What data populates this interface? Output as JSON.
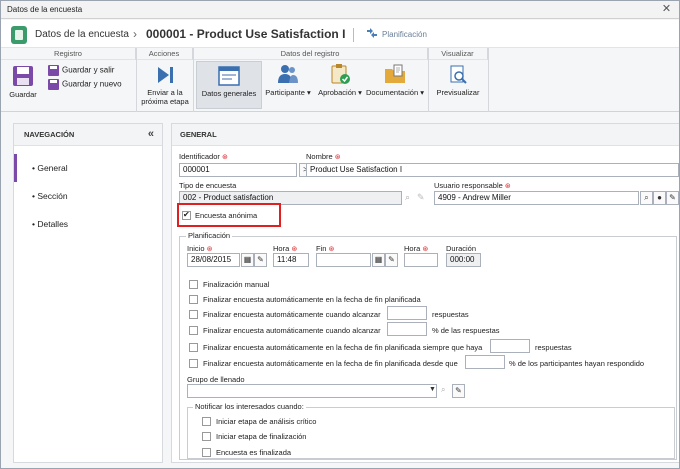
{
  "window": {
    "title": "Datos de la encuesta",
    "close_glyph": "✕"
  },
  "header": {
    "breadcrumb": "Datos de la encuesta",
    "separator": "›",
    "record_title": "000001 - Product Use Satisfaction I",
    "divider": "|",
    "planning_link": "Planificación",
    "app_icon": "survey-app-icon"
  },
  "ribbon": {
    "groups": [
      "Registro",
      "Acciones",
      "Datos del registro",
      "Visualizar"
    ],
    "save": "Guardar",
    "save_exit": "Guardar y salir",
    "save_new": "Guardar y nuevo",
    "send_next_1": "Enviar a la",
    "send_next_2": "próxima etapa",
    "general_data": "Datos generales",
    "participant": "Participante",
    "approval": "Aprobación",
    "documentation": "Documentación",
    "preview": "Previsualizar",
    "dropdown_glyph": "▾"
  },
  "sidebar": {
    "title": "NAVEGACIÓN",
    "collapse_glyph": "«",
    "items": [
      {
        "label": "• General"
      },
      {
        "label": "• Sección"
      },
      {
        "label": "• Detalles"
      }
    ]
  },
  "main": {
    "section_title": "GENERAL",
    "identifier_label": "Identificador",
    "identifier_value": "000001",
    "name_label": "Nombre",
    "name_value": "Product Use Satisfaction I",
    "survey_type_label": "Tipo de encuesta",
    "survey_type_value": "002 - Product satisfaction",
    "responsible_label": "Usuario responsable",
    "responsible_value": "4909 - Andrew Miller",
    "anonymous_label": "Encuesta anónima",
    "anonymous_checked": true,
    "planning_legend": "Planificación",
    "start_label": "Inicio",
    "start_value": "28/08/2015",
    "hour_label": "Hora",
    "start_hour_value": "11:48",
    "end_label": "Fin",
    "end_value": "",
    "end_hour_label": "Hora",
    "end_hour_value": "",
    "duration_label": "Duración",
    "duration_value": "000:00",
    "options": [
      "Finalización manual",
      "Finalizar encuesta automáticamente en la fecha de fin planificada",
      "Finalizar encuesta automáticamente cuando alcanzar",
      "Finalizar encuesta automáticamente cuando alcanzar",
      "Finalizar encuesta automáticamente en la fecha de fin planificada siempre que haya",
      "Finalizar encuesta automáticamente en la fecha de fin planificada desde que"
    ],
    "suffix_respuestas": "respuestas",
    "suffix_pct_respuestas": "% de las respuestas",
    "suffix_respuestas_2": "respuestas",
    "suffix_pct_participantes": "% de los participantes hayan respondido",
    "group_label": "Grupo de llenado",
    "group_value": "",
    "notify_legend": "Notificar los interesados cuando:",
    "notify_options": [
      "Iniciar etapa de análisis crítico",
      "Iniciar etapa de finalización",
      "Encuesta es finalizada"
    ]
  },
  "colors": {
    "accent": "#7b4aa8",
    "required": "#d9262b",
    "highlight": "#e02020"
  }
}
